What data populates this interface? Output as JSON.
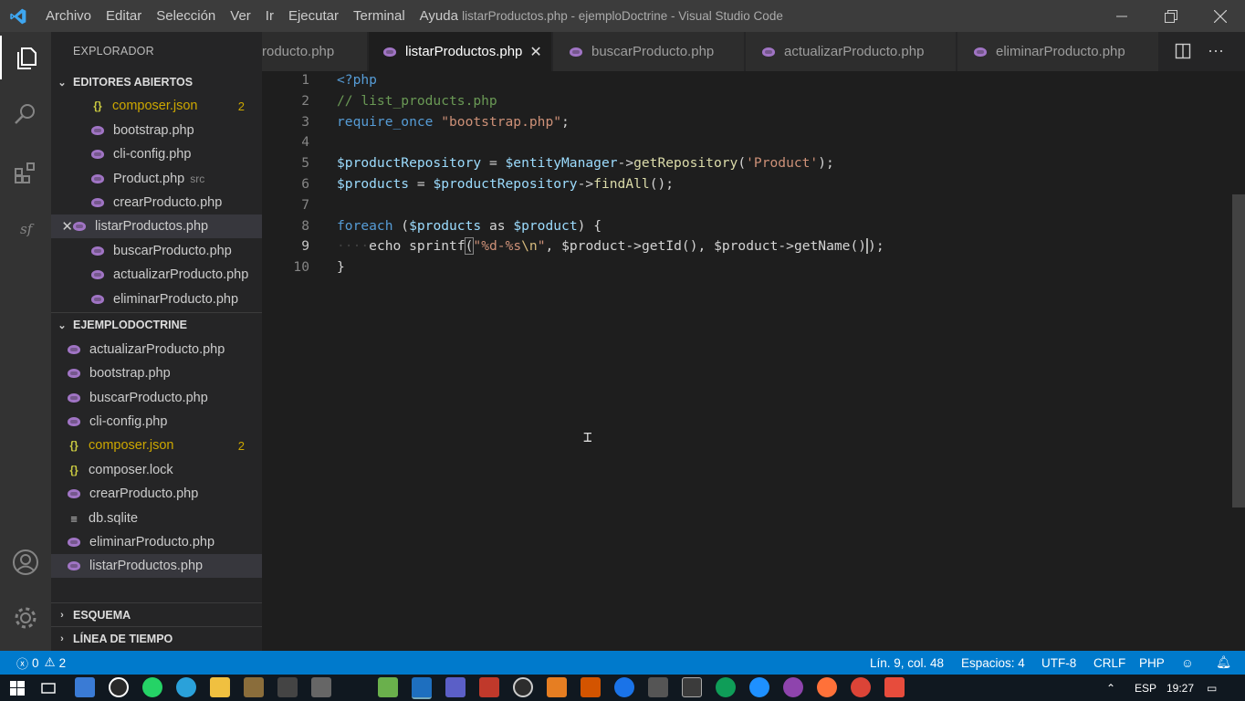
{
  "menu": [
    "Archivo",
    "Editar",
    "Selección",
    "Ver",
    "Ir",
    "Ejecutar",
    "Terminal",
    "Ayuda"
  ],
  "window_title": "listarProductos.php - ejemploDoctrine - Visual Studio Code",
  "sidebar": {
    "title": "EXPLORADOR",
    "open_editors_header": "EDITORES ABIERTOS",
    "open_editors": [
      {
        "label": "composer.json",
        "type": "json",
        "badge": "2"
      },
      {
        "label": "bootstrap.php",
        "type": "php"
      },
      {
        "label": "cli-config.php",
        "type": "php"
      },
      {
        "label": "Product.php",
        "type": "php",
        "desc": "src"
      },
      {
        "label": "crearProducto.php",
        "type": "php"
      },
      {
        "label": "listarProductos.php",
        "type": "php"
      },
      {
        "label": "buscarProducto.php",
        "type": "php"
      },
      {
        "label": "actualizarProducto.php",
        "type": "php"
      },
      {
        "label": "eliminarProducto.php",
        "type": "php"
      }
    ],
    "project_header": "EJEMPLODOCTRINE",
    "files": [
      {
        "label": "actualizarProducto.php",
        "type": "php"
      },
      {
        "label": "bootstrap.php",
        "type": "php"
      },
      {
        "label": "buscarProducto.php",
        "type": "php"
      },
      {
        "label": "cli-config.php",
        "type": "php"
      },
      {
        "label": "composer.json",
        "type": "json",
        "badge": "2"
      },
      {
        "label": "composer.lock",
        "type": "lock"
      },
      {
        "label": "crearProducto.php",
        "type": "php"
      },
      {
        "label": "db.sqlite",
        "type": "db"
      },
      {
        "label": "eliminarProducto.php",
        "type": "php"
      },
      {
        "label": "listarProductos.php",
        "type": "php"
      }
    ],
    "outline_header": "ESQUEMA",
    "timeline_header": "LÍNEA DE TIEMPO"
  },
  "tabs": [
    "roducto.php",
    "listarProductos.php",
    "buscarProducto.php",
    "actualizarProducto.php",
    "eliminarProducto.php"
  ],
  "line_numbers": [
    "1",
    "2",
    "3",
    "4",
    "5",
    "6",
    "7",
    "8",
    "9",
    "10"
  ],
  "code": {
    "l1": "<?php",
    "l2": "// list_products.php",
    "l3_kw": "require_once",
    "l3_str": "\"bootstrap.php\"",
    "l3_end": ";",
    "l5_var": "$productRepository",
    "l5_op": " = ",
    "l5_var2": "$entityManager",
    "l5_arrow": "->",
    "l5_fn": "getRepository",
    "l5_p1": "(",
    "l5_str": "'Product'",
    "l5_p2": ");",
    "l6_var": "$products",
    "l6_op": " = ",
    "l6_var2": "$productRepository",
    "l6_arrow": "->",
    "l6_fn": "findAll",
    "l6_end": "();",
    "l8_kw": "foreach",
    "l8_p1": " (",
    "l8_var": "$products",
    "l8_as": " as ",
    "l8_var2": "$product",
    "l8_end": ") {",
    "l9_indent": "····",
    "l9_kw": "echo",
    "l9_fn": "sprintf",
    "l9_p1": "(",
    "l9_str1": "\"%d-%s",
    "l9_esc": "\\n",
    "l9_str2": "\"",
    "l9_comma": ", ",
    "l9_var": "$product",
    "l9_arrow": "->",
    "l9_fn2": "getId",
    "l9_mid": "(), ",
    "l9_var2": "$product",
    "l9_arrow2": "->",
    "l9_fn3": "getName",
    "l9_end": "()",
    "l9_close": ");",
    "l10": "}"
  },
  "status": {
    "errors": "0",
    "warnings": "2",
    "position": "Lín. 9, col. 48",
    "spaces": "Espacios: 4",
    "encoding": "UTF-8",
    "eol": "CRLF",
    "language": "PHP"
  },
  "taskbar": {
    "lang": "ESP",
    "time": "19:27"
  },
  "colors": {
    "accent": "#007acc",
    "php_icon": "#a074c4",
    "warning": "#cca700"
  }
}
